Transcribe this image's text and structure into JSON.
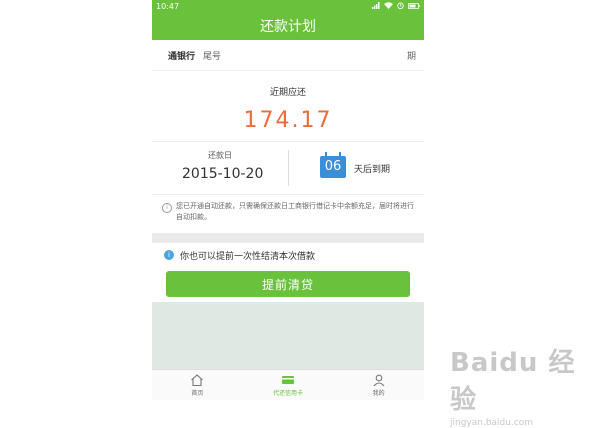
{
  "status_bar": {
    "time": "10:47"
  },
  "navbar": {
    "title": "还款计划"
  },
  "bank_row": {
    "bank_name": "通银行",
    "tail_label": "尾号",
    "period_label": "期"
  },
  "due": {
    "title": "近期应还",
    "amount": "174.17"
  },
  "date_block": {
    "label": "还款日",
    "date": "2015-10-20",
    "days": "06",
    "days_suffix": "天后到期"
  },
  "note": {
    "text": "您已开通自动还款，只需确保还款日工商银行借记卡中余额充足，届时将进行自动扣款。"
  },
  "early": {
    "text": "你也可以提前一次性结清本次借款",
    "button_label": "提前清贷"
  },
  "tabs": [
    {
      "label": "首页",
      "icon": "home-icon"
    },
    {
      "label": "代还信用卡",
      "icon": "credit-card-icon"
    },
    {
      "label": "我的",
      "icon": "user-icon"
    }
  ],
  "watermark": {
    "logo": "Baidu 经验",
    "url": "jingyan.baidu.com"
  },
  "colors": {
    "accent": "#6ac13b",
    "amount": "#f06b3a",
    "days_box": "#3b8fd8",
    "info_icon": "#48a5e0"
  }
}
